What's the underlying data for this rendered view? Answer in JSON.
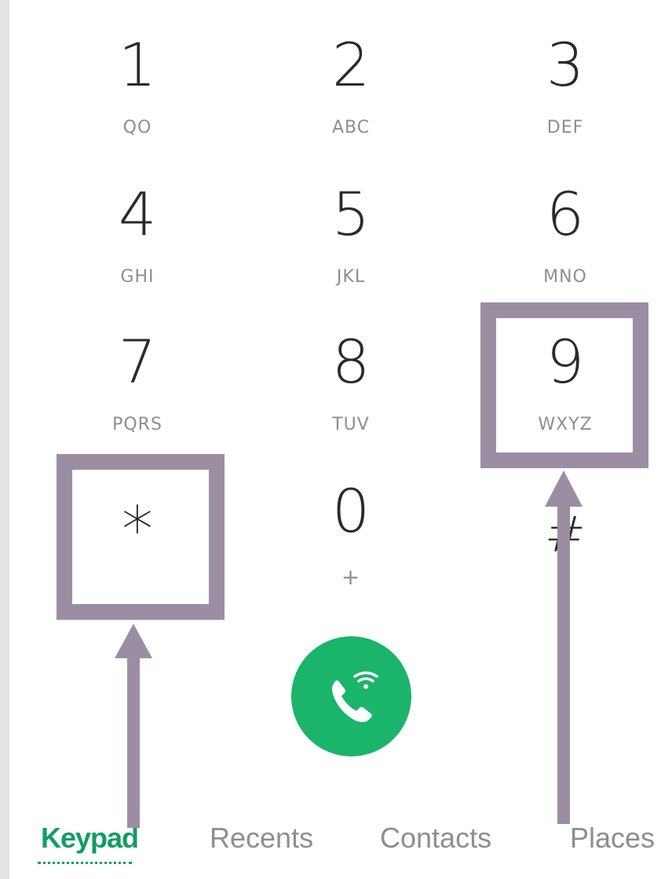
{
  "keypad": [
    {
      "digit": "1",
      "letters": "QO"
    },
    {
      "digit": "2",
      "letters": "ABC"
    },
    {
      "digit": "3",
      "letters": "DEF"
    },
    {
      "digit": "4",
      "letters": "GHI"
    },
    {
      "digit": "5",
      "letters": "JKL"
    },
    {
      "digit": "6",
      "letters": "MNO"
    },
    {
      "digit": "7",
      "letters": "PQRS"
    },
    {
      "digit": "8",
      "letters": "TUV"
    },
    {
      "digit": "9",
      "letters": "WXYZ"
    },
    {
      "digit": "*",
      "letters": ""
    },
    {
      "digit": "0",
      "letters": "+"
    },
    {
      "digit": "#",
      "letters": ""
    }
  ],
  "call_button": {
    "icon": "phone-wifi-icon",
    "color": "#1bb46b"
  },
  "tabs": [
    {
      "label": "Keypad",
      "active": true
    },
    {
      "label": "Recents",
      "active": false
    },
    {
      "label": "Contacts",
      "active": false
    },
    {
      "label": "Places",
      "active": false
    }
  ],
  "accent_color": "#0f9e63",
  "annotation_color": "#9b8ea3"
}
